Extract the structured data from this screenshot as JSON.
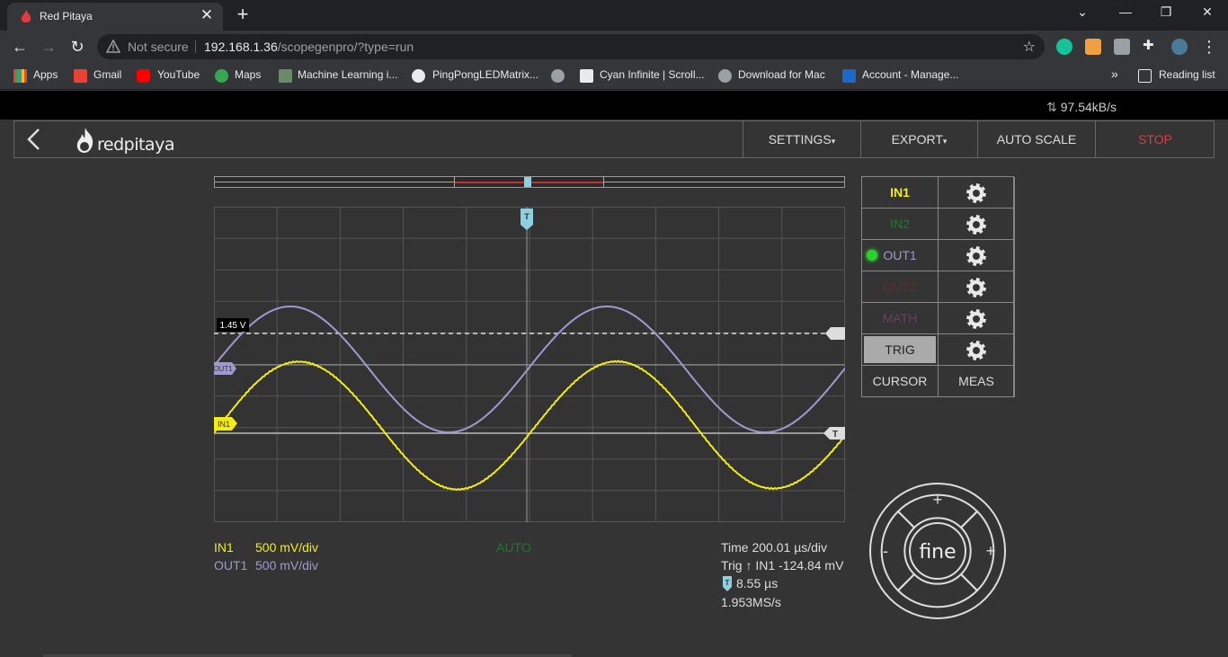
{
  "browser": {
    "tab_title": "Red Pitaya",
    "tab_close": "✕",
    "new_tab": "+",
    "url_warning": "Not secure",
    "url_host": "192.168.1.36",
    "url_path": "/scopegenpro/?type=run",
    "bookmarks": [
      "Apps",
      "Gmail",
      "YouTube",
      "Maps",
      "Machine Learning i...",
      "PingPongLEDMatrix...",
      "Cyan Infinite | Scroll...",
      "Download for Mac",
      "Account - Manage..."
    ],
    "bookmarks_more": "»",
    "reading_list": "Reading list"
  },
  "app": {
    "rate": "97.54kB/s",
    "logo_text": "redpitaya",
    "buttons": {
      "settings": "SETTINGS",
      "export": "EXPORT",
      "autoscale": "AUTO SCALE",
      "stop": "STOP"
    },
    "colors": {
      "in1": "#f3ec1c",
      "in2": "#1e7a28",
      "out1": "#9e9ad0",
      "out2": "#6b2a2a",
      "math": "#6b3e61",
      "stop": "#e0393e",
      "trigger_marker": "#8ecfe0"
    }
  },
  "scope": {
    "trigger_level_label": "1.45 V",
    "marker_out1": "OUT1",
    "marker_in1": "IN1",
    "marker_t": "T",
    "in1_label": "IN1",
    "in1_scale": "500 mV/div",
    "out1_label": "OUT1",
    "out1_scale": "500 mV/div",
    "mode": "AUTO",
    "time": "Time 200.01 µs/div",
    "trig": "Trig ↑ IN1 -124.84 mV",
    "trig_delay": "8.55 µs",
    "sample_rate": "1.953MS/s"
  },
  "channels": {
    "in1": "IN1",
    "in2": "IN2",
    "out1": "OUT1",
    "out2": "OUT2",
    "math": "MATH",
    "trig": "TRIG",
    "cursor": "CURSOR",
    "meas": "MEAS"
  },
  "joystick": {
    "center": "fine",
    "up": "+",
    "down": "−",
    "left": "-",
    "right": "+"
  }
}
